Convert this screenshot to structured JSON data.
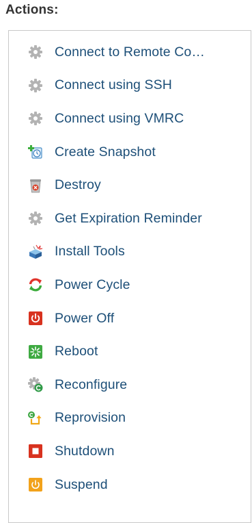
{
  "heading": "Actions:",
  "actions": [
    {
      "label": "Connect to Remote Co…",
      "icon": "gear-icon"
    },
    {
      "label": "Connect using SSH",
      "icon": "gear-icon"
    },
    {
      "label": "Connect using VMRC",
      "icon": "gear-icon"
    },
    {
      "label": "Create Snapshot",
      "icon": "snapshot-icon"
    },
    {
      "label": "Destroy",
      "icon": "trash-icon"
    },
    {
      "label": "Get Expiration Reminder",
      "icon": "gear-icon"
    },
    {
      "label": "Install Tools",
      "icon": "install-tools-icon"
    },
    {
      "label": "Power Cycle",
      "icon": "power-cycle-icon"
    },
    {
      "label": "Power Off",
      "icon": "power-off-icon"
    },
    {
      "label": "Reboot",
      "icon": "reboot-icon"
    },
    {
      "label": "Reconfigure",
      "icon": "reconfigure-icon"
    },
    {
      "label": "Reprovision",
      "icon": "reprovision-icon"
    },
    {
      "label": "Shutdown",
      "icon": "shutdown-icon"
    },
    {
      "label": "Suspend",
      "icon": "suspend-icon"
    }
  ],
  "colors": {
    "link": "#1d4f78",
    "heading": "#333333",
    "border": "#c8c8c8"
  }
}
